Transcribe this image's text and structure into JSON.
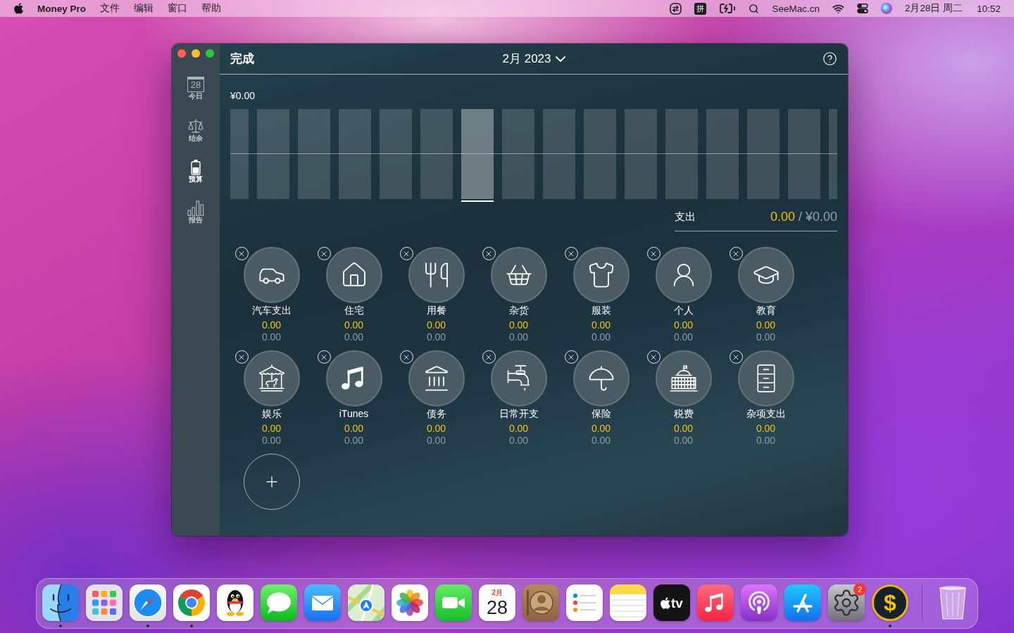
{
  "menu_bar": {
    "app_name": "Money Pro",
    "menus": [
      "文件",
      "编辑",
      "窗口",
      "帮助"
    ],
    "input_method": "拼",
    "status_text": "SeeMac.cn",
    "date": "2月28日 周二",
    "time": "10:52"
  },
  "sidebar": {
    "items": [
      {
        "label": "今日",
        "day": "28",
        "selected": false
      },
      {
        "label": "结余",
        "selected": false
      },
      {
        "label": "预算",
        "selected": true
      },
      {
        "label": "报告",
        "selected": false
      }
    ]
  },
  "header": {
    "done_button": "完成",
    "period": "2月 2023"
  },
  "chart": {
    "total": "¥0.00",
    "bars": [
      {
        "selected": false
      },
      {
        "selected": false
      },
      {
        "selected": false
      },
      {
        "selected": false
      },
      {
        "selected": false
      },
      {
        "selected": false
      },
      {
        "selected": true
      },
      {
        "selected": false
      },
      {
        "selected": false
      },
      {
        "selected": false
      },
      {
        "selected": false
      },
      {
        "selected": false
      },
      {
        "selected": false
      },
      {
        "selected": false
      },
      {
        "selected": false
      },
      {
        "selected": false
      }
    ]
  },
  "summary": {
    "label": "支出",
    "spent": "0.00",
    "budget": "/ ¥0.00"
  },
  "categories": {
    "editing": true,
    "items": [
      {
        "name": "汽车支出",
        "spent": "0.00",
        "budget": "0.00"
      },
      {
        "name": "住宅",
        "spent": "0.00",
        "budget": "0.00"
      },
      {
        "name": "用餐",
        "spent": "0.00",
        "budget": "0.00"
      },
      {
        "name": "杂货",
        "spent": "0.00",
        "budget": "0.00"
      },
      {
        "name": "服装",
        "spent": "0.00",
        "budget": "0.00"
      },
      {
        "name": "个人",
        "spent": "0.00",
        "budget": "0.00"
      },
      {
        "name": "教育",
        "spent": "0.00",
        "budget": "0.00"
      },
      {
        "name": "娱乐",
        "spent": "0.00",
        "budget": "0.00"
      },
      {
        "name": "iTunes",
        "spent": "0.00",
        "budget": "0.00"
      },
      {
        "name": "债务",
        "spent": "0.00",
        "budget": "0.00"
      },
      {
        "name": "日常开支",
        "spent": "0.00",
        "budget": "0.00"
      },
      {
        "name": "保险",
        "spent": "0.00",
        "budget": "0.00"
      },
      {
        "name": "税费",
        "spent": "0.00",
        "budget": "0.00"
      },
      {
        "name": "杂项支出",
        "spent": "0.00",
        "budget": "0.00"
      }
    ]
  },
  "dock": {
    "apps": [
      {
        "running": true
      },
      {
        "running": false
      },
      {
        "running": true
      },
      {
        "running": true
      },
      {
        "running": false
      },
      {
        "running": false
      },
      {
        "running": false
      },
      {
        "running": false
      },
      {
        "running": false
      },
      {
        "running": false
      },
      {
        "month": "2月",
        "day": "28",
        "running": false
      },
      {
        "running": false
      },
      {
        "running": false
      },
      {
        "running": false
      },
      {
        "text": "tv",
        "running": false
      },
      {
        "running": false
      },
      {
        "running": false
      },
      {
        "running": false
      },
      {
        "badge": "2",
        "running": false
      },
      {
        "text": "$",
        "running": true
      }
    ]
  }
}
